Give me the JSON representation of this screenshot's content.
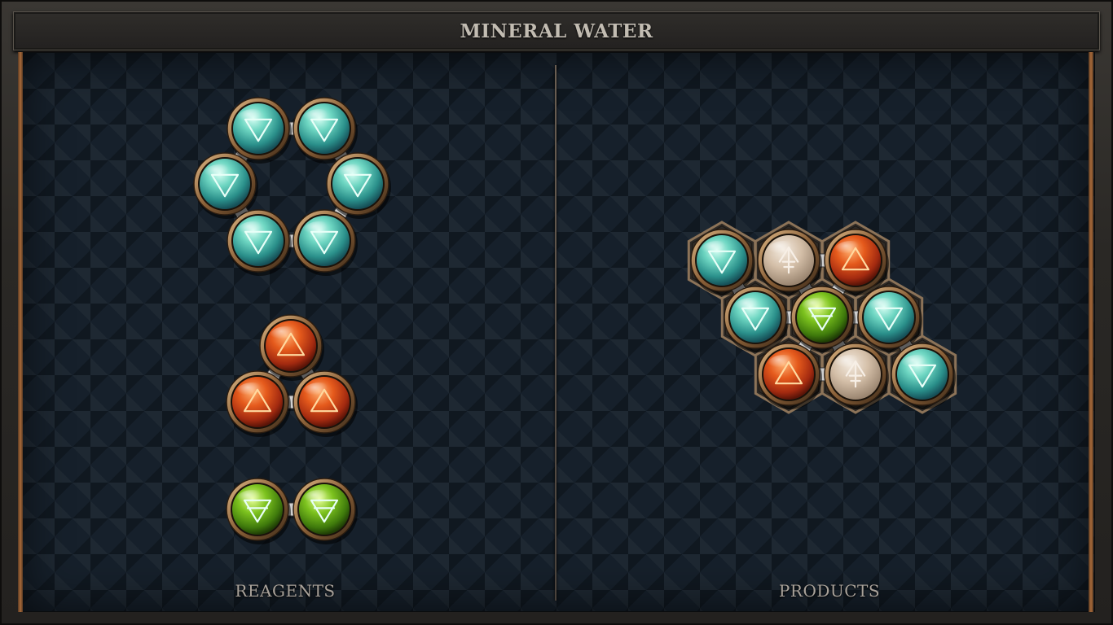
{
  "title": "MINERAL WATER",
  "panels": {
    "reagents_label": "REAGENTS",
    "products_label": "PRODUCTS"
  },
  "colors": {
    "water": "#3fb9a8",
    "fire": "#e0501c",
    "earth": "#6fb51a",
    "salt": "#cdb9a2",
    "accent_bronze": "#a27748"
  },
  "reagents": [
    {
      "name": "water-ring",
      "atoms": [
        "water",
        "water",
        "water",
        "water",
        "water",
        "water"
      ],
      "bonds": 6
    },
    {
      "name": "fire-triangle",
      "atoms": [
        "fire",
        "fire",
        "fire"
      ],
      "bonds": 3
    },
    {
      "name": "earth-pair",
      "atoms": [
        "earth",
        "earth"
      ],
      "bonds": 1
    }
  ],
  "product": {
    "name": "mineral-water",
    "atoms": [
      "water",
      "salt",
      "fire",
      "water",
      "earth",
      "water",
      "fire",
      "salt",
      "water"
    ],
    "bonds": 10
  }
}
